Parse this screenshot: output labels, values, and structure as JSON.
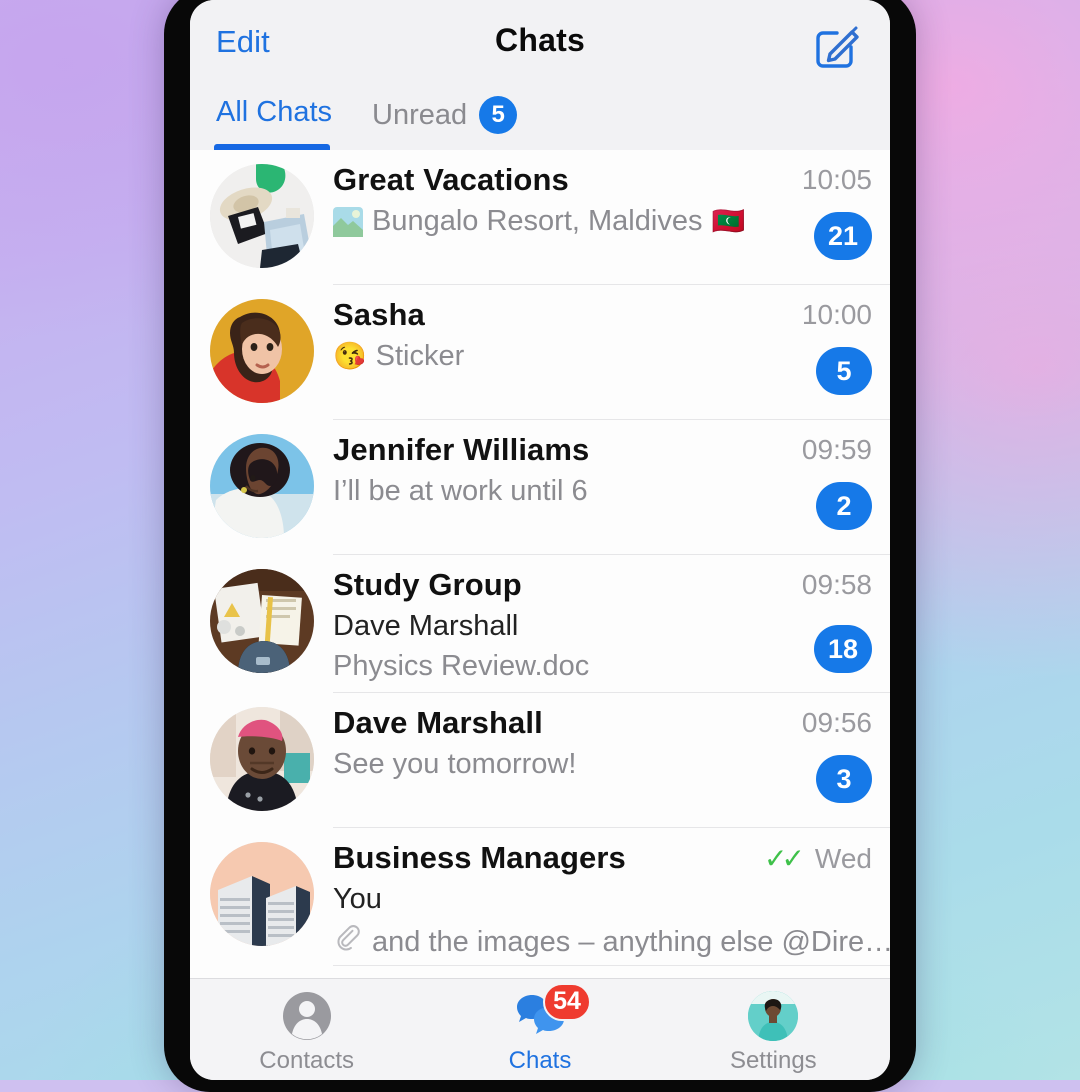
{
  "header": {
    "edit_label": "Edit",
    "title": "Chats",
    "compose_icon": "compose-pencil-square-icon"
  },
  "segments": {
    "all_chats_label": "All Chats",
    "unread_label": "Unread",
    "unread_count": "5"
  },
  "chats": [
    {
      "name": "Great Vacations",
      "avatar": "suitcase-packing-photo",
      "preview": "Bungalo Resort, Maldives",
      "preview_emoji": "🇲🇻",
      "has_thumb": true,
      "time": "10:05",
      "badge": "21",
      "sender": "",
      "attachment_icon": ""
    },
    {
      "name": "Sasha",
      "avatar": "woman-portrait-photo",
      "preview": "Sticker",
      "preview_emoji": "😘",
      "has_thumb": false,
      "time": "10:00",
      "badge": "5",
      "sender": "",
      "attachment_icon": ""
    },
    {
      "name": "Jennifer Williams",
      "avatar": "woman-profile-photo",
      "preview": "I’ll be at work until 6",
      "preview_emoji": "",
      "has_thumb": false,
      "time": "09:59",
      "badge": "2",
      "sender": "",
      "attachment_icon": ""
    },
    {
      "name": "Study Group",
      "avatar": "desk-notebooks-photo",
      "preview": "Physics Review.doc",
      "preview_emoji": "",
      "has_thumb": false,
      "time": "09:58",
      "badge": "18",
      "sender": "Dave Marshall",
      "attachment_icon": ""
    },
    {
      "name": "Dave Marshall",
      "avatar": "man-pink-hair-photo",
      "preview": "See you tomorrow!",
      "preview_emoji": "",
      "has_thumb": false,
      "time": "09:56",
      "badge": "3",
      "sender": "",
      "attachment_icon": ""
    },
    {
      "name": "Business Managers",
      "avatar": "city-buildings-photo",
      "preview": "and the images – anything else @Dire…",
      "preview_emoji": "",
      "has_thumb": false,
      "time": "Wed",
      "badge": "",
      "sender": "You",
      "attachment_icon": "paperclip-icon",
      "read_status": "double-check-read"
    }
  ],
  "tab_bar": [
    {
      "label": "Contacts",
      "icon": "person-circle-icon",
      "badge": "",
      "active": false
    },
    {
      "label": "Chats",
      "icon": "chat-bubbles-icon",
      "badge": "54",
      "active": true
    },
    {
      "label": "Settings",
      "icon": "profile-avatar-icon",
      "badge": "",
      "active": false
    }
  ],
  "colors": {
    "accent_blue": "#1f72e0",
    "badge_blue": "#1679e8",
    "badge_red": "#ef3b2f",
    "read_green": "#3fc14a"
  }
}
